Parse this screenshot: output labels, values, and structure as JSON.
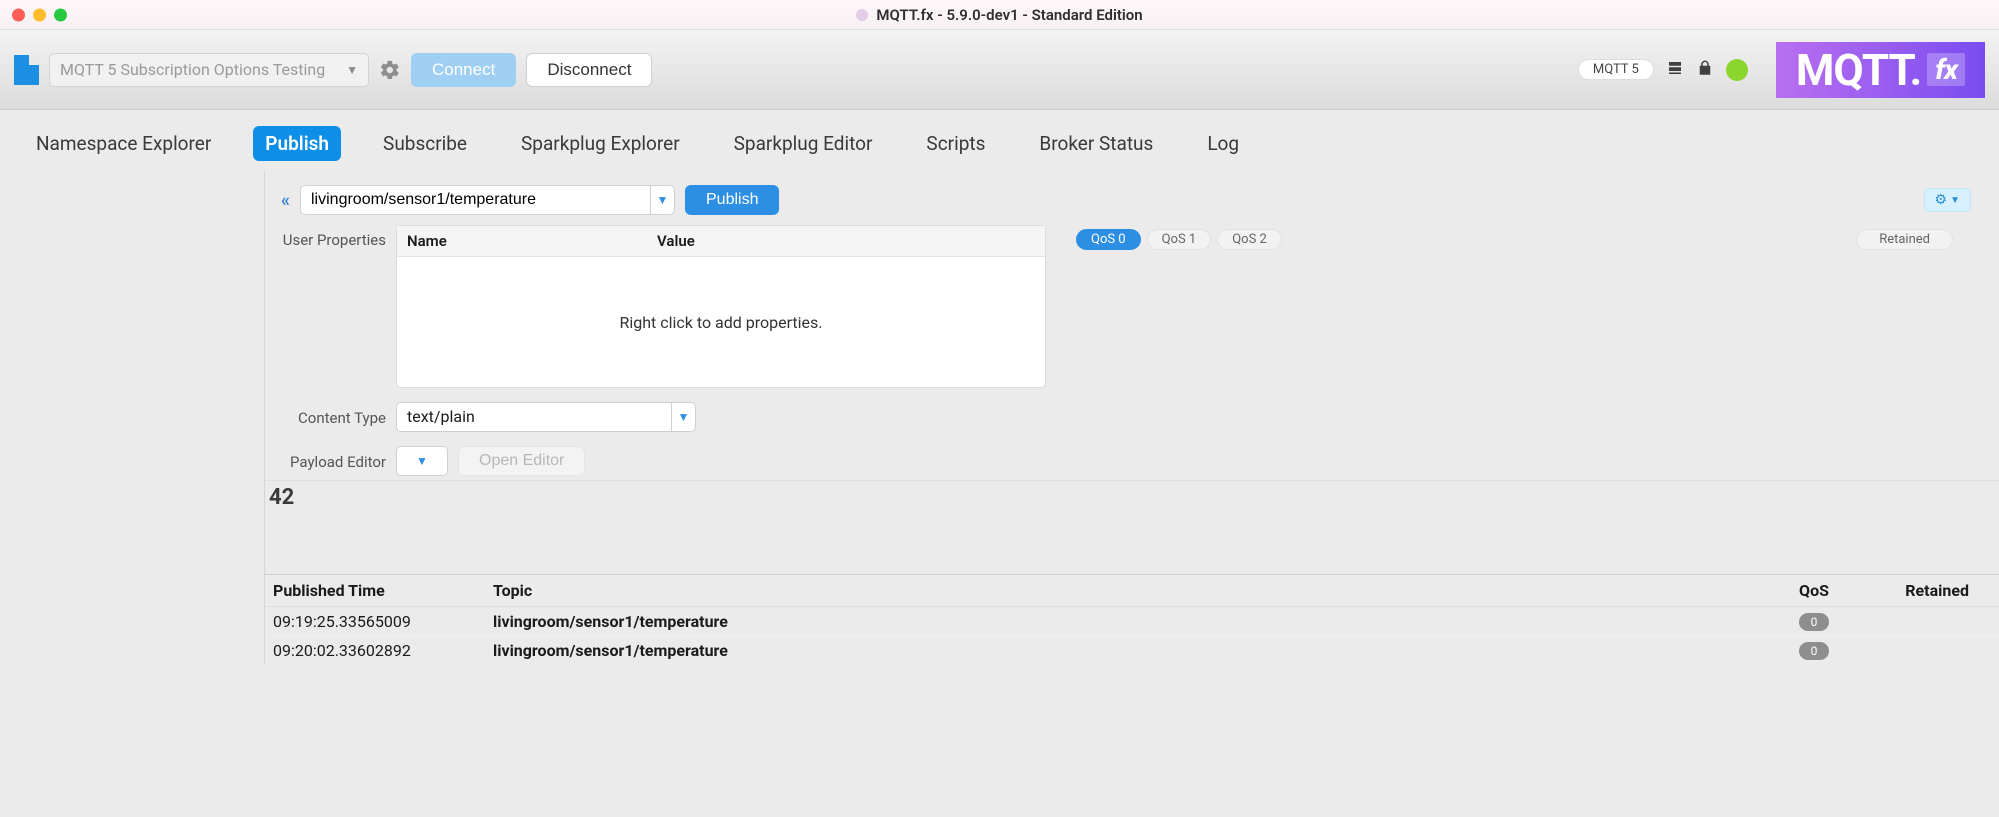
{
  "title": "MQTT.fx - 5.9.0-dev1 - Standard Edition",
  "toolbar": {
    "profile_name": "MQTT 5 Subscription Options Testing",
    "connect_label": "Connect",
    "disconnect_label": "Disconnect",
    "protocol_badge": "MQTT 5",
    "brand_main": "MQTT.",
    "brand_sub": "fx"
  },
  "tabs": {
    "namespace": "Namespace Explorer",
    "publish": "Publish",
    "subscribe": "Subscribe",
    "sparkplug_explorer": "Sparkplug Explorer",
    "sparkplug_editor": "Sparkplug Editor",
    "scripts": "Scripts",
    "broker_status": "Broker Status",
    "log": "Log",
    "active": "publish"
  },
  "publish": {
    "topic": "livingroom/sensor1/temperature",
    "publish_button": "Publish",
    "user_properties_label": "User Properties",
    "user_properties_header_name": "Name",
    "user_properties_header_value": "Value",
    "user_properties_placeholder": "Right click to add properties.",
    "qos0": "QoS 0",
    "qos1": "QoS 1",
    "qos2": "QoS 2",
    "retained": "Retained",
    "content_type_label": "Content Type",
    "content_type_value": "text/plain",
    "payload_editor_label": "Payload Editor",
    "open_editor_label": "Open Editor",
    "payload_value": "42"
  },
  "history": {
    "col_time": "Published Time",
    "col_topic": "Topic",
    "col_qos": "QoS",
    "col_retained": "Retained",
    "rows": [
      {
        "time": "09:19:25.33565009",
        "topic": "livingroom/sensor1/temperature",
        "qos": "0",
        "retained": ""
      },
      {
        "time": "09:20:02.33602892",
        "topic": "livingroom/sensor1/temperature",
        "qos": "0",
        "retained": ""
      }
    ]
  }
}
